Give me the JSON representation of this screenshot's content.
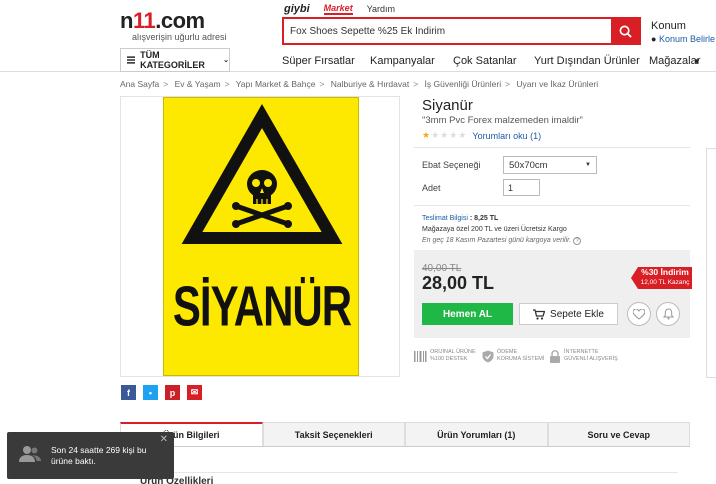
{
  "header": {
    "logo_prefix": "n",
    "logo_mid": "11",
    "logo_suffix": ".com",
    "slogan": "alışverişin uğurlu adresi",
    "top_links": [
      "giybi",
      "Market",
      "Yardım"
    ],
    "search_value": "Fox Shoes Sepette %25 Ek İndirim",
    "location_title": "Konum",
    "location_link": "Konum Belirle"
  },
  "nav": {
    "categories_label": "TÜM KATEGORİLER",
    "items": [
      "Süper Fırsatlar",
      "Kampanyalar",
      "Çok Satanlar",
      "Yurt Dışından Ürünler",
      "Mağazalar"
    ]
  },
  "breadcrumb": [
    "Ana Sayfa",
    "Ev & Yaşam",
    "Yapı Market & Bahçe",
    "Nalburiye & Hırdavat",
    "İş Güvenliği Ürünleri",
    "Uyarı ve İkaz Ürünleri"
  ],
  "product": {
    "image_text": "SİYANÜR",
    "title": "Siyanür",
    "subtitle": "\"3mm Pvc Forex malzemeden imaldir\"",
    "rating": 1,
    "reviews_link": "Yorumları oku (1)",
    "variant_label": "Ebat Seçeneği",
    "variant_value": "50x70cm",
    "qty_label": "Adet",
    "qty_value": "1",
    "shipping_label": "Teslimat Bilgisi",
    "shipping_cost": ": 8,25 TL",
    "shipping_free": "Mağazaya özel 200 TL ve üzeri Ücretsiz Kargo",
    "shipping_date": "En geç 18 Kasım Pazartesi günü kargoya verilir.",
    "old_price": "40,00 TL",
    "price": "28,00 TL",
    "discount": "%30 İndirim",
    "discount_sub": "12,00 TL Kazanç",
    "buy_now": "Hemen AL",
    "add_to_cart": "Sepete Ekle"
  },
  "trust_badges": [
    {
      "line1": "ORİJİNAL ÜRÜNE",
      "line2": "%100 DESTEK"
    },
    {
      "line1": "ÖDEME",
      "line2": "KORUMA SİSTEMİ"
    },
    {
      "line1": "İNTERNETTE",
      "line2": "GÜVENLİ ALIŞVERİŞ"
    }
  ],
  "tabs": [
    "Ürün Bilgileri",
    "Taksit Seçenekleri",
    "Ürün Yorumları (1)",
    "Soru ve Cevap"
  ],
  "section_title": "Ürün Özellikleri",
  "toast": {
    "message": "Son 24 saatte 269 kişi bu ürüne baktı."
  },
  "colors": {
    "brand_red": "#d81f26",
    "buy_green": "#1fb745",
    "sign_yellow": "#fde800",
    "link_blue": "#1a5ca8"
  }
}
